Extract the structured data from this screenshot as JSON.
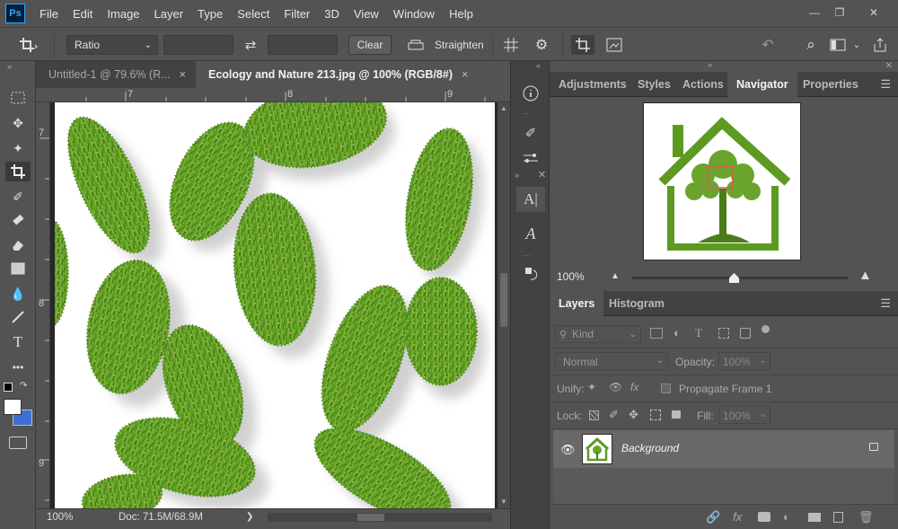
{
  "app": {
    "logo": "Ps"
  },
  "menu": [
    "File",
    "Edit",
    "Image",
    "Layer",
    "Type",
    "Select",
    "Filter",
    "3D",
    "View",
    "Window",
    "Help"
  ],
  "window_controls": {
    "minimize": "—",
    "restore": "❐",
    "close": "✕"
  },
  "options_bar": {
    "ratio": "Ratio",
    "width_value": "",
    "height_value": "",
    "clear": "Clear",
    "straighten": "Straighten",
    "swap_icon": "⇄",
    "gear_icon": "⚙",
    "undo_icon": "↶",
    "search_icon": "⌕"
  },
  "tools": [
    "marquee-icon",
    "move-icon",
    "magic-wand-icon",
    "crop-icon",
    "brush-icon",
    "healing-icon",
    "eraser-icon",
    "gradient-icon",
    "blur-icon",
    "pen-icon",
    "type-icon",
    "more-tools-icon",
    "swap-colors-icon",
    "color-swatches",
    "quick-mask-icon"
  ],
  "colors": {
    "foreground": "#ffffff",
    "background": "#3d6fd4",
    "accent": "#31a8ff"
  },
  "tabs": [
    {
      "label": "Untitled-1 @ 79.6% (R...",
      "close": "×"
    },
    {
      "label": "Ecology and Nature 213.jpg @ 100% (RGB/8#)",
      "close": "×"
    }
  ],
  "rulers": {
    "h": [
      "7",
      "8",
      "9"
    ],
    "v": [
      "7",
      "8",
      "9"
    ]
  },
  "status": {
    "zoom": "100%",
    "doc": "Doc: 71.5M/68.9M",
    "arrow": "❯"
  },
  "right_panel": {
    "top_tabs": [
      "Adjustments",
      "Styles",
      "Actions",
      "Navigator",
      "Properties"
    ],
    "navigator_zoom": "100%",
    "navigator_zoom_level": 0.45,
    "layers_tabs": [
      "Layers",
      "Histogram"
    ],
    "kind": "Kind",
    "blend_mode": "Normal",
    "opacity_label": "Opacity:",
    "opacity_value": "100%",
    "unify_label": "Unify:",
    "propagate_label": "Propagate Frame 1",
    "lock_label": "Lock:",
    "fill_label": "Fill:",
    "fill_value": "100%",
    "layer_name": "Background"
  }
}
